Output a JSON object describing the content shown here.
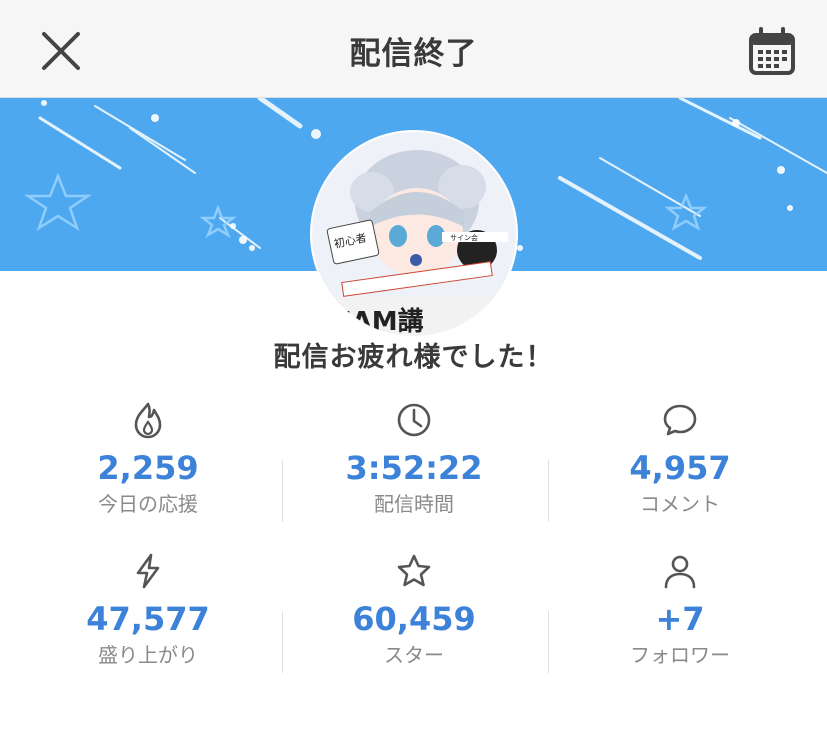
{
  "header": {
    "title": "配信終了"
  },
  "message": "配信お疲れ様でした！",
  "stats": [
    {
      "value": "2,259",
      "label": "今日の応援",
      "icon": "fire-icon"
    },
    {
      "value": "3:52:22",
      "label": "配信時間",
      "icon": "clock-icon"
    },
    {
      "value": "4,957",
      "label": "コメント",
      "icon": "comment-icon"
    },
    {
      "value": "47,577",
      "label": "盛り上がり",
      "icon": "lightning-icon"
    },
    {
      "value": "60,459",
      "label": "スター",
      "icon": "star-icon"
    },
    {
      "value": "+7",
      "label": "フォロワー",
      "icon": "person-icon"
    }
  ],
  "colors": {
    "accent": "#3b82d8",
    "banner": "#4ea8f0",
    "label": "#8a8a8a"
  }
}
